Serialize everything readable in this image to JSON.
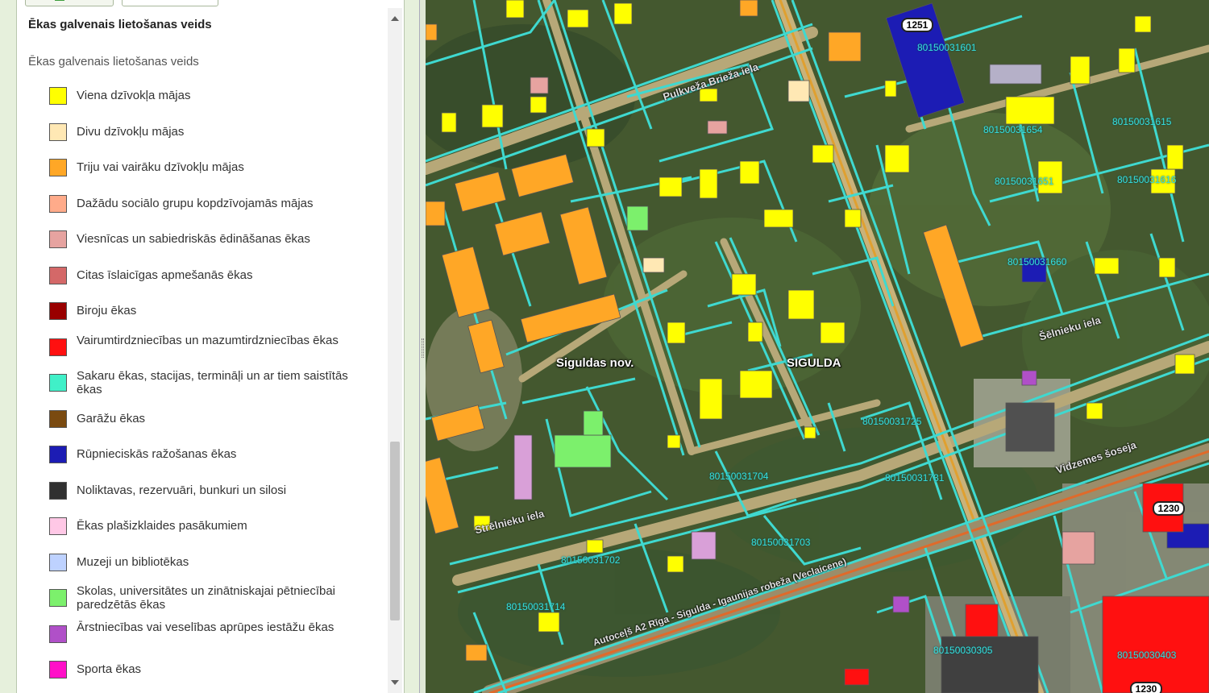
{
  "legend": {
    "heading": "Ēkas galvenais lietošanas veids",
    "subheading": "Ēkas galvenais lietošanas veids",
    "items": [
      {
        "label": "Viena dzīvokļa mājas",
        "color": "#ffff00"
      },
      {
        "label": "Divu dzīvokļu mājas",
        "color": "#ffe8b4"
      },
      {
        "label": "Triju vai vairāku dzīvokļu mājas",
        "color": "#ffa726"
      },
      {
        "label": "Dažādu sociālo grupu kopdzīvojamās mājas",
        "color": "#ffab8a"
      },
      {
        "label": "Viesnīcas un sabiedriskās ēdināšanas ēkas",
        "color": "#e6a3a0"
      },
      {
        "label": "Citas īslaicīgas apmešanās ēkas",
        "color": "#d46868"
      },
      {
        "label": "Biroju ēkas",
        "color": "#990000"
      },
      {
        "label": "Vairumtirdzniecības un mazumtirdzniecības ēkas",
        "color": "#ff1010"
      },
      {
        "label": "Sakaru ēkas, stacijas, termināļi un ar tiem saistītās ēkas",
        "color": "#40f0c8"
      },
      {
        "label": "Garāžu ēkas",
        "color": "#7a4a10"
      },
      {
        "label": "Rūpnieciskās ražošanas ēkas",
        "color": "#1c1cb4"
      },
      {
        "label": "Noliktavas, rezervuāri, bunkuri un silosi",
        "color": "#303030"
      },
      {
        "label": "Ēkas plašizklaides pasākumiem",
        "color": "#ffc8e6"
      },
      {
        "label": "Muzeji un bibliotēkas",
        "color": "#bed2ff"
      },
      {
        "label": "Skolas, universitātes un zinātniskajai pētniecībai paredzētās ēkas",
        "color": "#7cf06c"
      },
      {
        "label": "Ārstniecības vai veselības aprūpes iestāžu ēkas",
        "color": "#b050c8"
      },
      {
        "label": "Sporta ēkas",
        "color": "#ff10c8"
      }
    ]
  },
  "map": {
    "place_labels": [
      "Siguldas nov.",
      "SIGULDA"
    ],
    "street_labels": [
      "Pulkveža Brieža iela",
      "Strēlnieku iela",
      "Vidzemes šoseja",
      "Šēlnieku iela"
    ],
    "parcel_labels": [
      "80150031601",
      "80150031654",
      "80150031615",
      "80150031616",
      "80150031651",
      "80150031660",
      "80150031725",
      "80150031704",
      "80150031731",
      "80150031703",
      "80150031702",
      "80150031714",
      "80150030403",
      "80150030305"
    ],
    "road_badges": [
      "1251",
      "1230",
      "1230"
    ],
    "road_text": "Autoceļš A2 Rīga - Sigulda - Igaunijas robeža (Veclaicene)",
    "colors": {
      "parcel_line": "#3fd9d0",
      "street": "#c9b27a",
      "highway": "#e07a2a",
      "vegetation": "#3f5a2c"
    }
  }
}
